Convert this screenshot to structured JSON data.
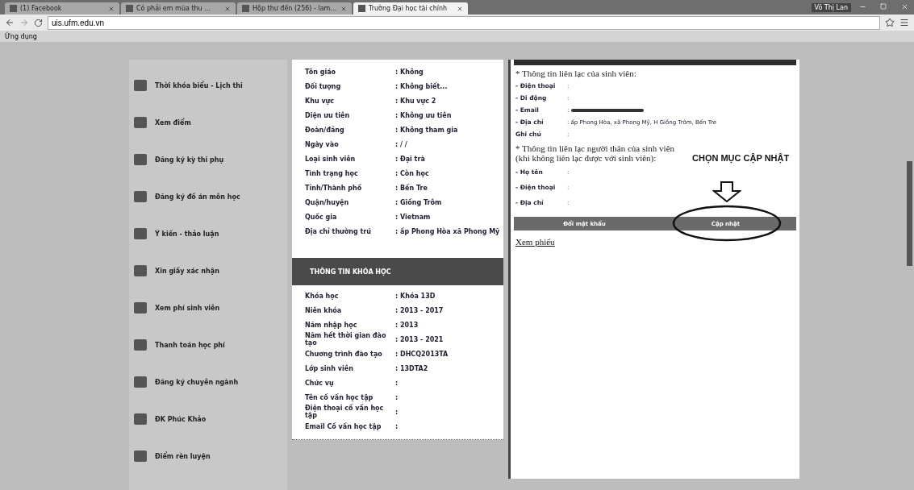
{
  "browser": {
    "tabs": [
      {
        "label": "(1) Facebook",
        "selected": false
      },
      {
        "label": "Có phải em mùa thu ...",
        "selected": false
      },
      {
        "label": "Hộp thư đến (256) - lam...",
        "selected": false
      },
      {
        "label": "Trường Đại học tài chính",
        "selected": true
      }
    ],
    "user": "Võ Thị Lan",
    "url": "uis.ufm.edu.vn",
    "bookmarks": [
      "Ứng dụng"
    ]
  },
  "sidebar": {
    "items": [
      {
        "label": "Thời khóa biểu - Lịch thi"
      },
      {
        "label": "Xem điểm"
      },
      {
        "label": "Đăng ký kỳ thi phụ"
      },
      {
        "label": "Đăng ký đồ án môn học"
      },
      {
        "label": "Ý kiến - thảo luận"
      },
      {
        "label": "Xin giấy xác nhận"
      },
      {
        "label": "Xem phí sinh viên"
      },
      {
        "label": "Thanh toán học phí"
      },
      {
        "label": "Đăng ký chuyên ngành"
      },
      {
        "label": "ĐK Phúc Khảo"
      },
      {
        "label": "Điểm rèn luyện"
      }
    ]
  },
  "personal_info": {
    "rows": [
      {
        "label": "Tôn giáo",
        "value": ": Không"
      },
      {
        "label": "Đối tượng",
        "value": ": Không biết..."
      },
      {
        "label": "Khu vực",
        "value": ": Khu vực 2"
      },
      {
        "label": "Diện ưu tiên",
        "value": ": Không ưu tiên"
      },
      {
        "label": "Đoàn/đảng",
        "value": ": Không tham gia"
      },
      {
        "label": "Ngày vào",
        "value": ": / /"
      },
      {
        "label": "Loại sinh viên",
        "value": ": Đại trà"
      },
      {
        "label": "Tình trạng học",
        "value": ": Còn học"
      },
      {
        "label": "Tỉnh/Thành phố",
        "value": ": Bến Tre"
      },
      {
        "label": "Quận/huyện",
        "value": ": Giồng Trôm"
      },
      {
        "label": "Quốc gia",
        "value": ": Vietnam"
      },
      {
        "label": "Địa chỉ thường trú",
        "value": ": ấp Phong Hòa xã Phong Mỹ"
      }
    ]
  },
  "course_info": {
    "title": "THÔNG TIN KHÓA HỌC",
    "rows": [
      {
        "label": "Khóa học",
        "value": ": Khóa 13D"
      },
      {
        "label": "Niên khóa",
        "value": ": 2013 - 2017"
      },
      {
        "label": "Năm nhập học",
        "value": ": 2013"
      },
      {
        "label": "Năm hết thời gian đào tạo",
        "value": ": 2013 - 2021"
      },
      {
        "label": "Chương trình đào tạo",
        "value": ": DHCQ2013TA"
      },
      {
        "label": "Lớp sinh viên",
        "value": ": 13DTA2"
      },
      {
        "label": "Chức vụ",
        "value": ":"
      },
      {
        "label": "Tên cố vấn học tập",
        "value": ":"
      },
      {
        "label": "Điện thoại cố vấn học tập",
        "value": ":"
      },
      {
        "label": "Email Cố vấn học tập",
        "value": ":"
      }
    ]
  },
  "contact": {
    "student_heading": "* Thông tin liên lạc của sinh viên:",
    "student_rows": [
      {
        "label": "- Điện thoại",
        "value": ":",
        "redacted": false
      },
      {
        "label": "- Di động",
        "value": ":",
        "redacted": false
      },
      {
        "label": "- Email",
        "value": ":",
        "redacted": true
      },
      {
        "label": "- Địa chỉ",
        "value": ":  ấp Phong Hòa, xã Phong Mỹ, H Giồng Trôm, Bến Tre",
        "redacted": false
      },
      {
        "label": "Ghi chú",
        "value": ":",
        "redacted": false
      }
    ],
    "relative_heading": "* Thông tin liên lạc người thân của sinh viên (khi không liên lạc được với sinh viên):",
    "relative_rows": [
      {
        "label": "- Họ tên",
        "value": ":"
      },
      {
        "label": "- Điện thoại",
        "value": ":"
      },
      {
        "label": "- Địa chỉ",
        "value": ":"
      }
    ],
    "buttons": [
      "Đổi mật khẩu",
      "Cập nhật"
    ],
    "link": "Xem phiếu"
  },
  "annotation": {
    "text": "CHỌN MỤC CẬP NHẬT"
  }
}
